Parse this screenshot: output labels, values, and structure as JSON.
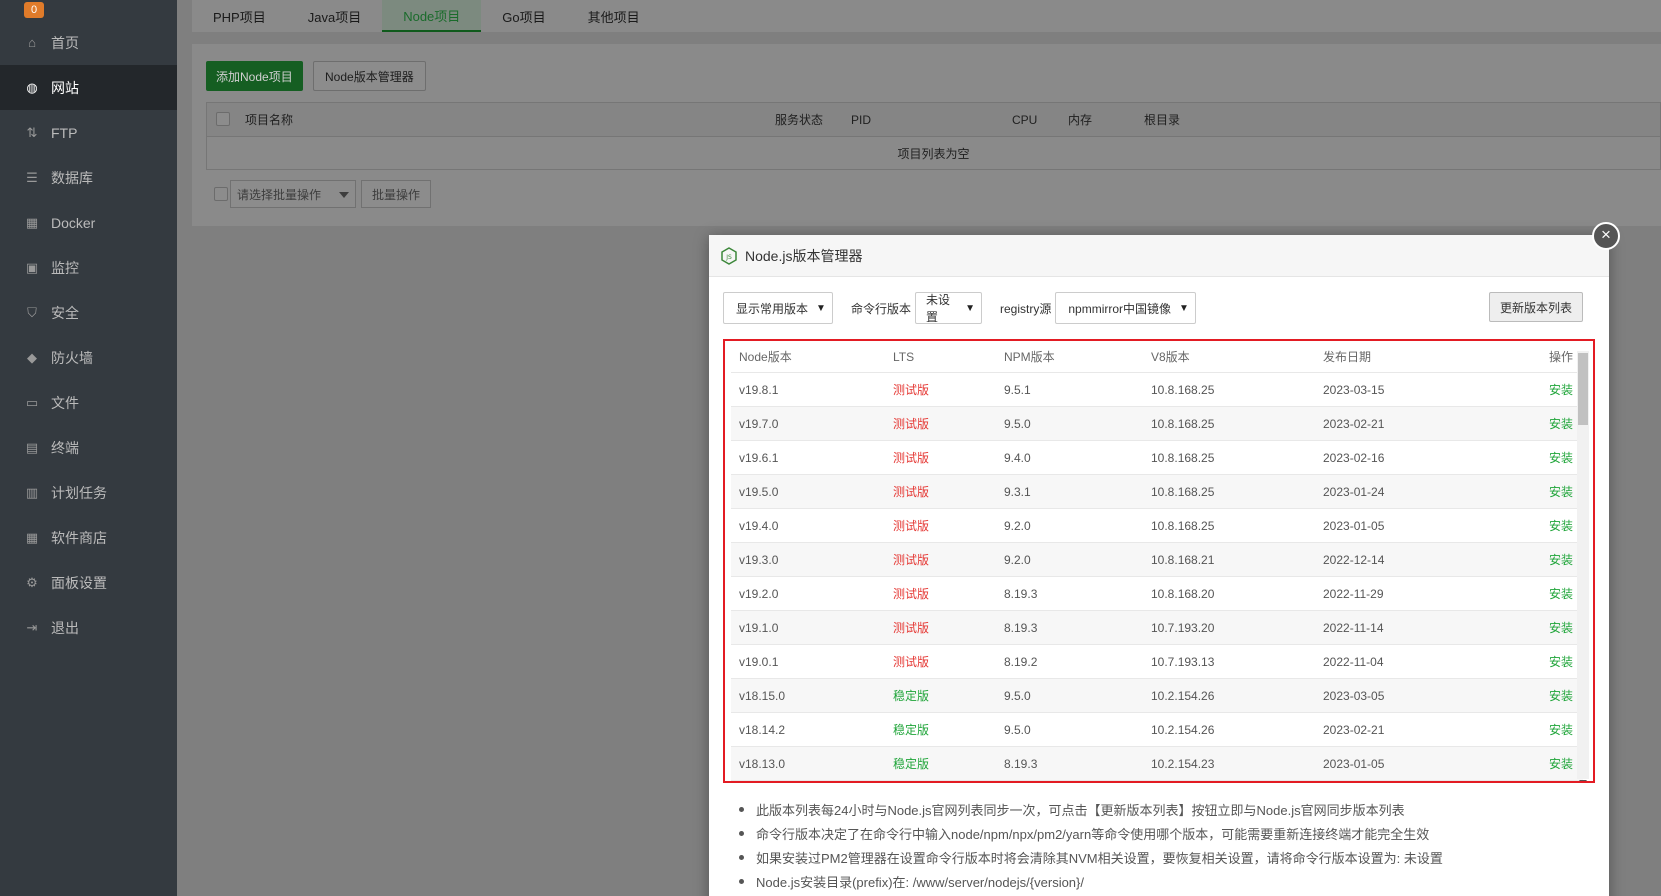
{
  "sidebar": {
    "brand_badge": "0",
    "items": [
      {
        "label": "首页",
        "icon": "home-icon"
      },
      {
        "label": "网站",
        "icon": "globe-icon",
        "active": true
      },
      {
        "label": "FTP",
        "icon": "ftp-icon"
      },
      {
        "label": "数据库",
        "icon": "database-icon"
      },
      {
        "label": "Docker",
        "icon": "docker-icon"
      },
      {
        "label": "监控",
        "icon": "monitor-icon"
      },
      {
        "label": "安全",
        "icon": "shield-icon"
      },
      {
        "label": "防火墙",
        "icon": "firewall-icon"
      },
      {
        "label": "文件",
        "icon": "folder-icon"
      },
      {
        "label": "终端",
        "icon": "terminal-icon"
      },
      {
        "label": "计划任务",
        "icon": "calendar-icon"
      },
      {
        "label": "软件商店",
        "icon": "grid-icon"
      },
      {
        "label": "面板设置",
        "icon": "gear-icon"
      },
      {
        "label": "退出",
        "icon": "logout-icon"
      }
    ]
  },
  "tabs": [
    "PHP项目",
    "Java项目",
    "Node项目",
    "Go项目",
    "其他项目"
  ],
  "toolbar": {
    "add_label": "添加Node项目",
    "manager_label": "Node版本管理器"
  },
  "project_table": {
    "columns": [
      "项目名称",
      "服务状态",
      "PID",
      "CPU",
      "内存",
      "根目录"
    ],
    "empty_text": "项目列表为空"
  },
  "batch": {
    "select_placeholder": "请选择批量操作",
    "button_label": "批量操作"
  },
  "modal": {
    "title": "Node.js版本管理器",
    "filter_select": "显示常用版本",
    "cli_label": "命令行版本",
    "cli_select": "未设置",
    "registry_label": "registry源",
    "registry_select": "npmmirror中国镜像",
    "update_button": "更新版本列表",
    "columns": [
      "Node版本",
      "LTS",
      "NPM版本",
      "V8版本",
      "发布日期",
      "操作"
    ],
    "rows": [
      {
        "node": "v19.8.1",
        "lts": "测试版",
        "stable": false,
        "npm": "9.5.1",
        "v8": "10.8.168.25",
        "date": "2023-03-15",
        "action": "安装"
      },
      {
        "node": "v19.7.0",
        "lts": "测试版",
        "stable": false,
        "npm": "9.5.0",
        "v8": "10.8.168.25",
        "date": "2023-02-21",
        "action": "安装"
      },
      {
        "node": "v19.6.1",
        "lts": "测试版",
        "stable": false,
        "npm": "9.4.0",
        "v8": "10.8.168.25",
        "date": "2023-02-16",
        "action": "安装"
      },
      {
        "node": "v19.5.0",
        "lts": "测试版",
        "stable": false,
        "npm": "9.3.1",
        "v8": "10.8.168.25",
        "date": "2023-01-24",
        "action": "安装"
      },
      {
        "node": "v19.4.0",
        "lts": "测试版",
        "stable": false,
        "npm": "9.2.0",
        "v8": "10.8.168.25",
        "date": "2023-01-05",
        "action": "安装"
      },
      {
        "node": "v19.3.0",
        "lts": "测试版",
        "stable": false,
        "npm": "9.2.0",
        "v8": "10.8.168.21",
        "date": "2022-12-14",
        "action": "安装"
      },
      {
        "node": "v19.2.0",
        "lts": "测试版",
        "stable": false,
        "npm": "8.19.3",
        "v8": "10.8.168.20",
        "date": "2022-11-29",
        "action": "安装"
      },
      {
        "node": "v19.1.0",
        "lts": "测试版",
        "stable": false,
        "npm": "8.19.3",
        "v8": "10.7.193.20",
        "date": "2022-11-14",
        "action": "安装"
      },
      {
        "node": "v19.0.1",
        "lts": "测试版",
        "stable": false,
        "npm": "8.19.2",
        "v8": "10.7.193.13",
        "date": "2022-11-04",
        "action": "安装"
      },
      {
        "node": "v18.15.0",
        "lts": "稳定版",
        "stable": true,
        "npm": "9.5.0",
        "v8": "10.2.154.26",
        "date": "2023-03-05",
        "action": "安装"
      },
      {
        "node": "v18.14.2",
        "lts": "稳定版",
        "stable": true,
        "npm": "9.5.0",
        "v8": "10.2.154.26",
        "date": "2023-02-21",
        "action": "安装"
      },
      {
        "node": "v18.13.0",
        "lts": "稳定版",
        "stable": true,
        "npm": "8.19.3",
        "v8": "10.2.154.23",
        "date": "2023-01-05",
        "action": "安装"
      }
    ],
    "notes": [
      "此版本列表每24小时与Node.js官网列表同步一次，可点击【更新版本列表】按钮立即与Node.js官网同步版本列表",
      "命令行版本决定了在命令行中输入node/npm/npx/pm2/yarn等命令使用哪个版本，可能需要重新连接终端才能完全生效",
      "如果安装过PM2管理器在设置命令行版本时将会清除其NVM相关设置，要恢复相关设置，请将命令行版本设置为: 未设置",
      "Node.js安装目录(prefix)在: /www/server/nodejs/{version}/"
    ]
  },
  "colors": {
    "accent_green": "#20a53a",
    "beta_red": "#e53935",
    "highlight_border": "#e31b23",
    "sidebar_bg": "#343a40"
  }
}
